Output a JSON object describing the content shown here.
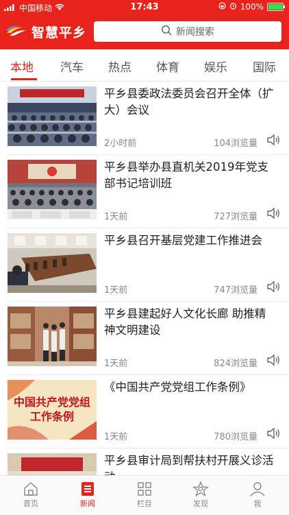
{
  "status_bar": {
    "carrier": "中国移动",
    "time": "17:43",
    "battery": "100%"
  },
  "header": {
    "app_name": "智慧平乡",
    "search_placeholder": "新闻搜索"
  },
  "tabs": [
    {
      "label": "本地",
      "active": true
    },
    {
      "label": "汽车"
    },
    {
      "label": "热点"
    },
    {
      "label": "体育"
    },
    {
      "label": "娱乐"
    },
    {
      "label": "国际"
    }
  ],
  "news": [
    {
      "title": "平乡县委政法委员会召开全体（扩大）会议",
      "time": "2小时前",
      "views": "104浏览量"
    },
    {
      "title": "平乡县举办县直机关2019年党支部书记培训班",
      "time": "1天前",
      "views": "727浏览量"
    },
    {
      "title": "平乡县召开基层党建工作推进会",
      "time": "1天前",
      "views": "747浏览量"
    },
    {
      "title": "平乡县建起好人文化长廊 助推精神文明建设",
      "time": "1天前",
      "views": "824浏览量"
    },
    {
      "title": "《中国共产党党组工作条例》",
      "time": "1天前",
      "views": "780浏览量",
      "image_text": "中国共产党党组工作条例"
    },
    {
      "title": "平乡县审计局到帮扶村开展义诊活动",
      "time": "",
      "views": ""
    }
  ],
  "bottom_nav": [
    {
      "label": "首页",
      "icon": "home-icon"
    },
    {
      "label": "新闻",
      "icon": "news-icon",
      "active": true
    },
    {
      "label": "栏目",
      "icon": "grid-icon"
    },
    {
      "label": "发现",
      "icon": "discover-icon"
    },
    {
      "label": "我",
      "icon": "user-icon"
    }
  ],
  "colors": {
    "brand_red": "#e8231b",
    "text": "#222222",
    "meta": "#888888"
  }
}
